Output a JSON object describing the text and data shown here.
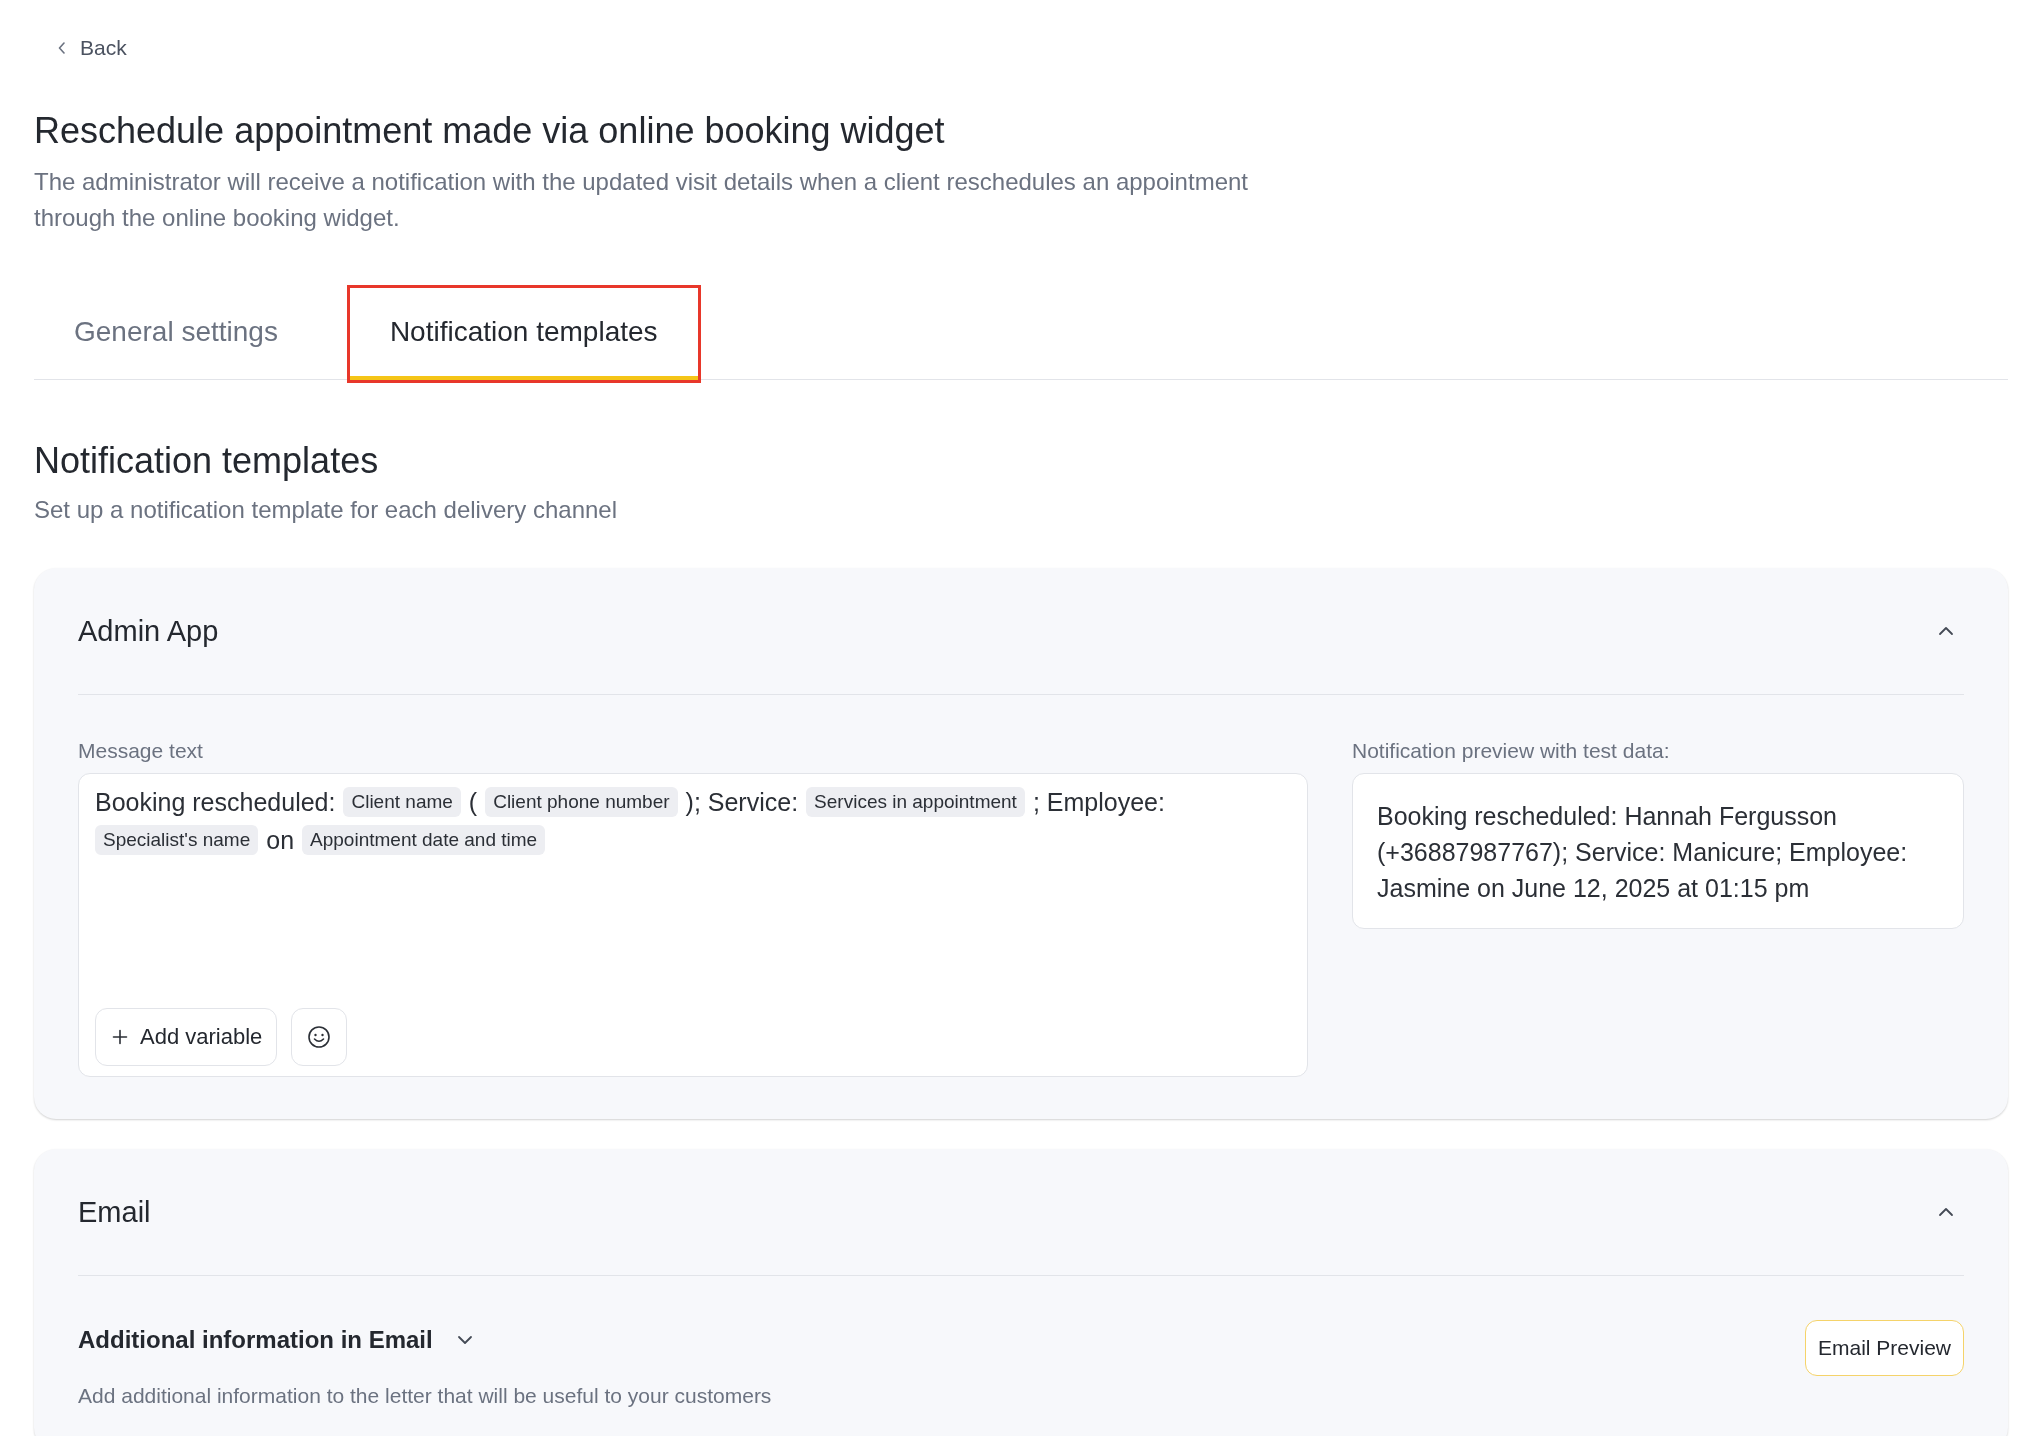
{
  "back_link": "Back",
  "page": {
    "title": "Reschedule appointment made via online booking widget",
    "description": "The administrator will receive a notification with the updated visit details when a client reschedules an appointment through the online booking widget."
  },
  "tabs": [
    {
      "label": "General settings",
      "selected": false,
      "highlighted": false
    },
    {
      "label": "Notification templates",
      "selected": true,
      "highlighted": true
    }
  ],
  "section": {
    "title": "Notification templates",
    "subtitle": "Set up a notification template for each delivery channel"
  },
  "admin_app": {
    "title": "Admin App",
    "expanded": true,
    "message_label": "Message text",
    "message": [
      {
        "kind": "text",
        "text": "Booking rescheduled:"
      },
      {
        "kind": "variable",
        "text": "Client name"
      },
      {
        "kind": "text",
        "text": "("
      },
      {
        "kind": "variable",
        "text": "Client phone number"
      },
      {
        "kind": "text",
        "text": "); Service:"
      },
      {
        "kind": "variable",
        "text": "Services in appointment"
      },
      {
        "kind": "text",
        "text": "; Employee:"
      },
      {
        "kind": "variable",
        "text": "Specialist's name"
      },
      {
        "kind": "text",
        "text": "on"
      },
      {
        "kind": "variable",
        "text": "Appointment date and time"
      }
    ],
    "add_variable_button": "Add variable",
    "preview_label": "Notification preview with test data:",
    "preview_text": "Booking rescheduled: Hannah Fergusson (+36887987767); Service: Manicure; Employee: Jasmine on June 12, 2025 at 01:15 pm"
  },
  "email": {
    "title": "Email",
    "expanded": true,
    "additional_title": "Additional information in Email",
    "additional_expanded": false,
    "additional_description": "Add additional information to the letter that will be useful to your customers",
    "preview_button": "Email Preview"
  }
}
